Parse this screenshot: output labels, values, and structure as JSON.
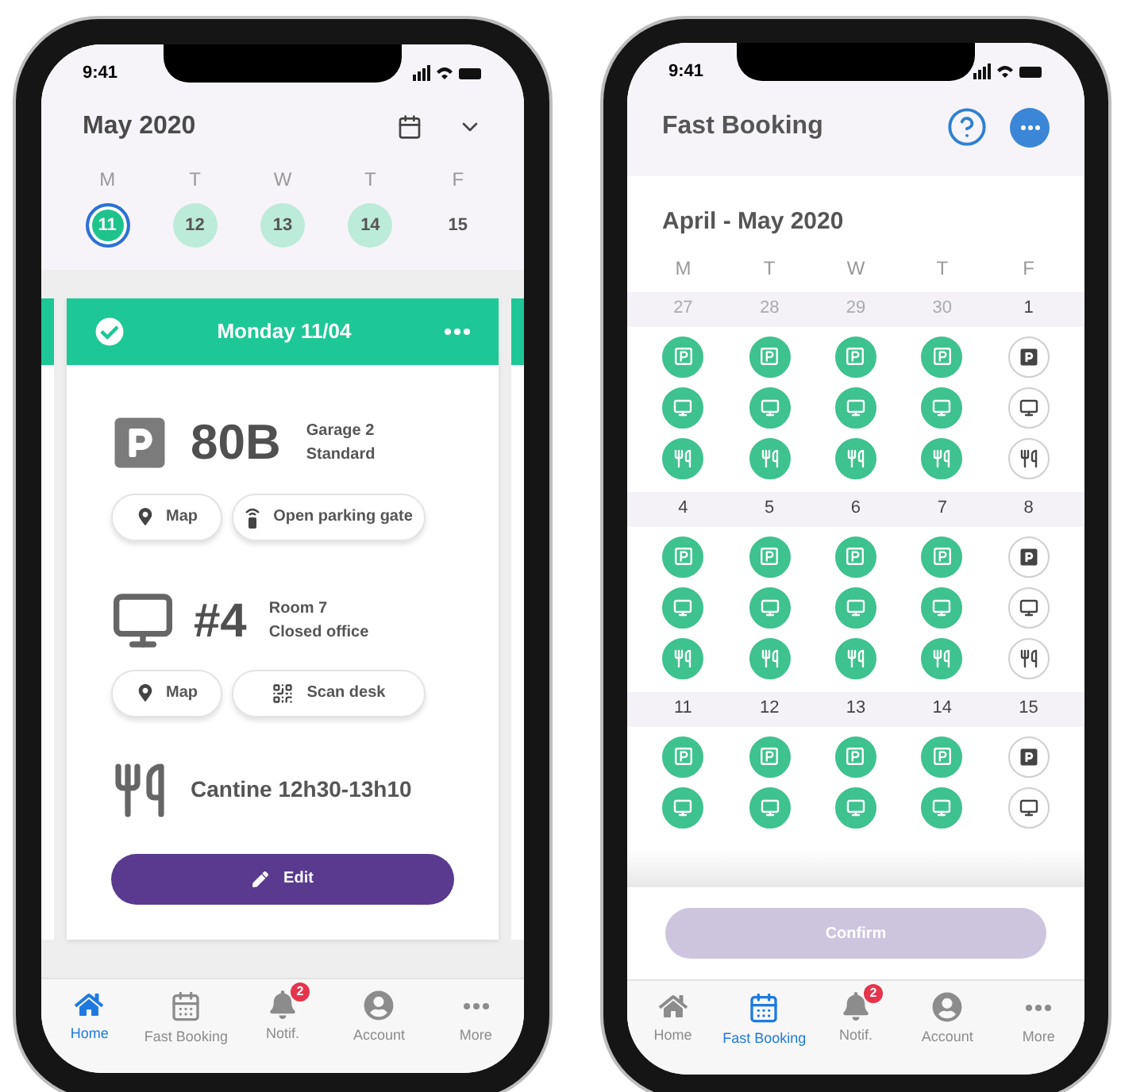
{
  "home_screen": {
    "status_bar": {
      "time": "9:41"
    },
    "header": {
      "title": "May 2020"
    },
    "week": {
      "days": [
        {
          "letter": "M",
          "number": "11",
          "selected": true,
          "booked": true
        },
        {
          "letter": "T",
          "number": "12",
          "selected": false,
          "booked": true
        },
        {
          "letter": "W",
          "number": "13",
          "selected": false,
          "booked": true
        },
        {
          "letter": "T",
          "number": "14",
          "selected": false,
          "booked": true
        },
        {
          "letter": "F",
          "number": "15",
          "selected": false,
          "booked": false
        }
      ]
    },
    "card": {
      "title": "Monday 11/04",
      "confirmed": true,
      "parking": {
        "code": "80B",
        "lines": [
          "Garage 2",
          "Standard"
        ],
        "actions": [
          {
            "kind": "map",
            "label": "Map"
          },
          {
            "kind": "gate",
            "label": "Open parking gate"
          }
        ]
      },
      "desk": {
        "code": "#4",
        "lines": [
          "Room 7",
          "Closed office"
        ],
        "actions": [
          {
            "kind": "map",
            "label": "Map"
          },
          {
            "kind": "qr",
            "label": "Scan desk"
          }
        ]
      },
      "canteen": {
        "label": "Cantine 12h30-13h10"
      },
      "edit_button": "Edit"
    },
    "tab_bar": [
      {
        "kind": "home",
        "label": "Home",
        "selected": true
      },
      {
        "kind": "calendar",
        "label": "Fast Booking",
        "selected": false
      },
      {
        "kind": "bell",
        "label": "Notif.",
        "selected": false,
        "badge": "2"
      },
      {
        "kind": "account",
        "label": "Account",
        "selected": false
      },
      {
        "kind": "more",
        "label": "More",
        "selected": false
      }
    ]
  },
  "booking_screen": {
    "status_bar": {
      "time": "9:41"
    },
    "header": {
      "title": "Fast Booking"
    },
    "month": "April - May 2020",
    "weekdays": [
      "M",
      "T",
      "W",
      "T",
      "F"
    ],
    "weeks": [
      {
        "days": [
          {
            "number": "27",
            "muted": true,
            "booked": true
          },
          {
            "number": "28",
            "muted": true,
            "booked": true
          },
          {
            "number": "29",
            "muted": true,
            "booked": true
          },
          {
            "number": "30",
            "muted": true,
            "booked": true
          },
          {
            "number": "1",
            "muted": false,
            "booked": false
          }
        ],
        "slots": [
          {
            "kind": "parking"
          },
          {
            "kind": "desk"
          },
          {
            "kind": "meal"
          }
        ]
      },
      {
        "days": [
          {
            "number": "4",
            "muted": false,
            "booked": true
          },
          {
            "number": "5",
            "muted": false,
            "booked": true
          },
          {
            "number": "6",
            "muted": false,
            "booked": true
          },
          {
            "number": "7",
            "muted": false,
            "booked": true
          },
          {
            "number": "8",
            "muted": false,
            "booked": false
          }
        ],
        "slots": [
          {
            "kind": "parking"
          },
          {
            "kind": "desk"
          },
          {
            "kind": "meal"
          }
        ]
      },
      {
        "days": [
          {
            "number": "11",
            "muted": false,
            "booked": true
          },
          {
            "number": "12",
            "muted": false,
            "booked": true
          },
          {
            "number": "13",
            "muted": false,
            "booked": true
          },
          {
            "number": "14",
            "muted": false,
            "booked": true
          },
          {
            "number": "15",
            "muted": false,
            "booked": false
          }
        ],
        "slots": [
          {
            "kind": "parking"
          },
          {
            "kind": "desk"
          }
        ]
      }
    ],
    "confirm_button": {
      "label": "Confirm",
      "disabled": true
    },
    "tab_bar": [
      {
        "kind": "home",
        "label": "Home",
        "selected": false
      },
      {
        "kind": "calendar",
        "label": "Fast Booking",
        "selected": true
      },
      {
        "kind": "bell",
        "label": "Notif.",
        "selected": false,
        "badge": "2"
      },
      {
        "kind": "account",
        "label": "Account",
        "selected": false
      },
      {
        "kind": "more",
        "label": "More",
        "selected": false
      }
    ]
  }
}
